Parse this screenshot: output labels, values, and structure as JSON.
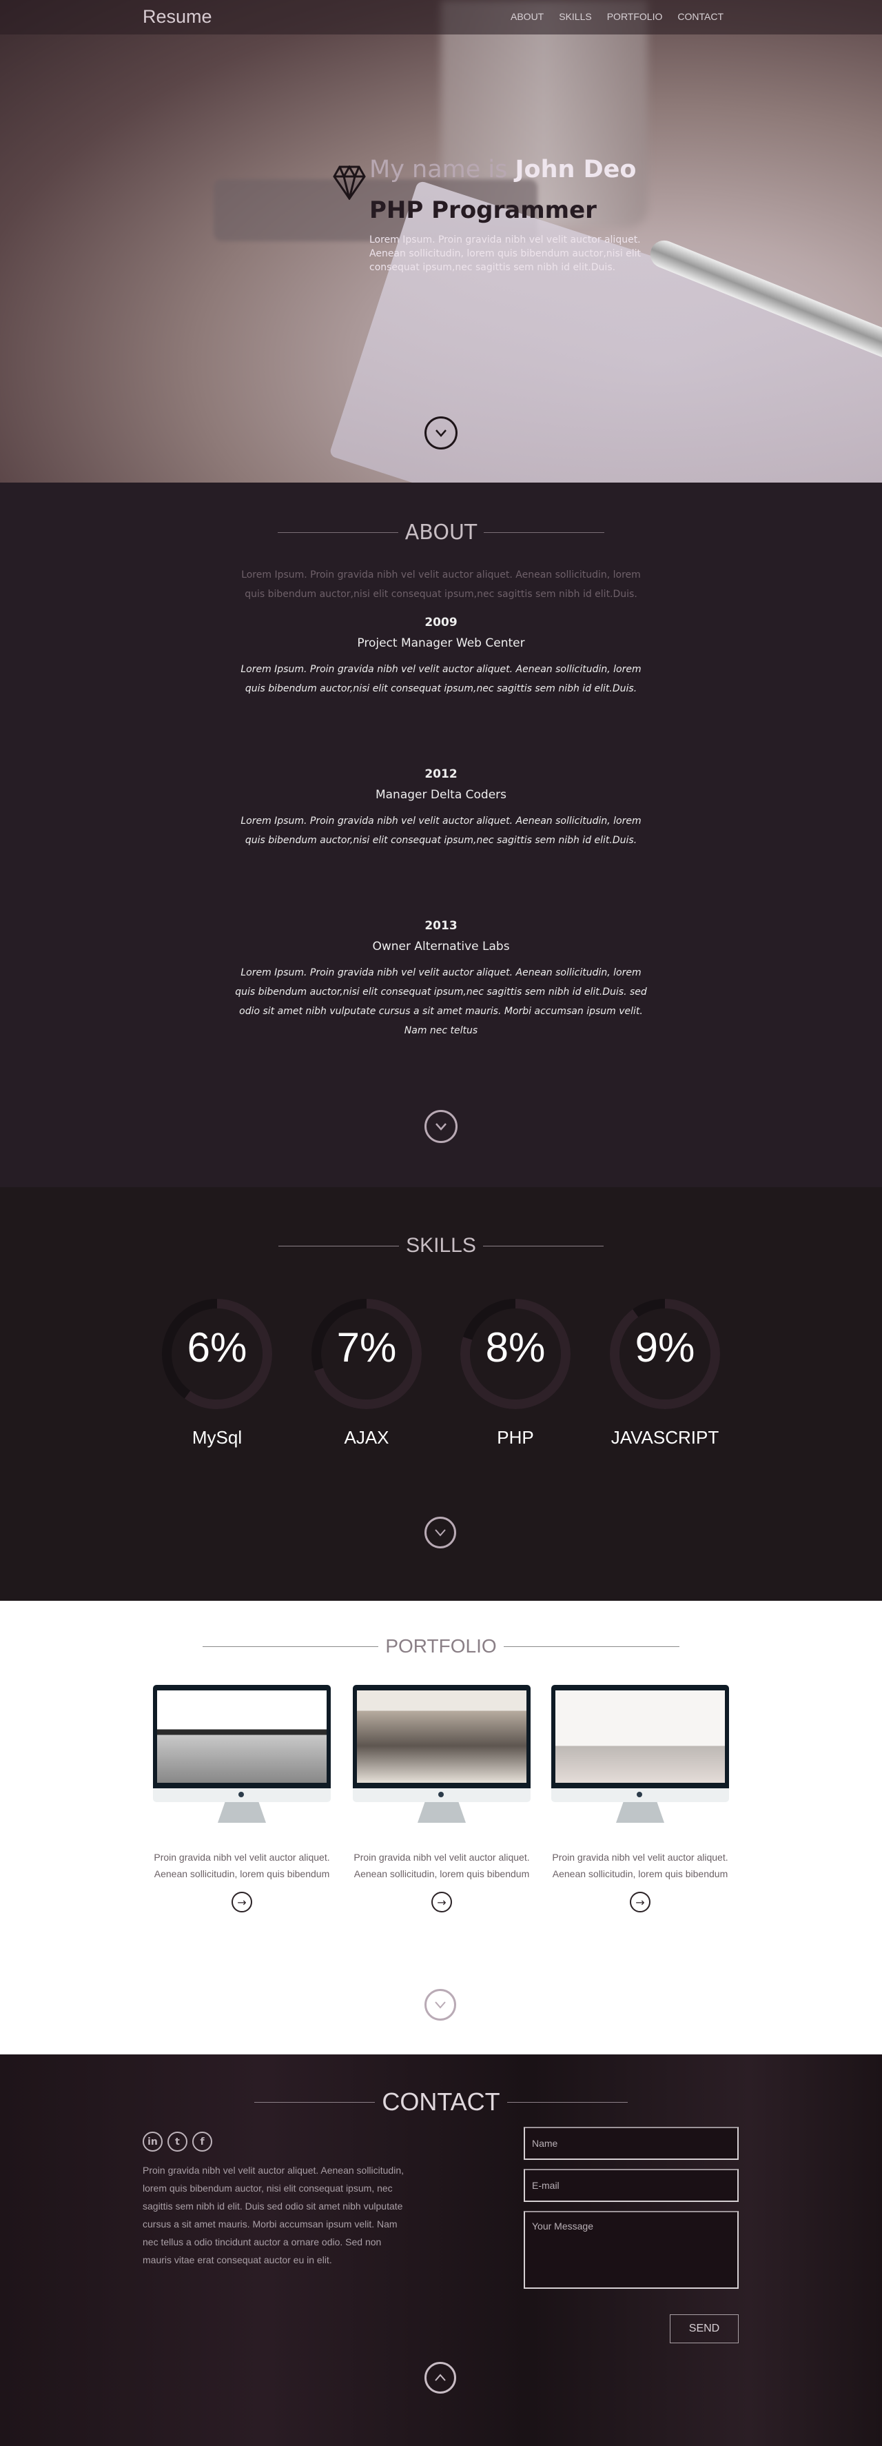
{
  "nav": {
    "brand": "Resume",
    "links": [
      "ABOUT",
      "SKILLS",
      "PORTFOLIO",
      "CONTACT"
    ]
  },
  "hero": {
    "intro": "My name is ",
    "name": "John Deo",
    "role": "PHP Programmer",
    "description": "Lorem Ipsum. Proin gravida nibh vel velit auctor aliquet. Aenean sollicitudin, lorem quis bibendum auctor,nisi elit consequat ipsum,nec sagittis sem nibh id elit.Duis.",
    "icon": "diamond-icon"
  },
  "about": {
    "title": "ABOUT",
    "intro": "Lorem Ipsum. Proin gravida nibh vel velit auctor aliquet. Aenean sollicitudin, lorem quis bibendum auctor,nisi elit consequat ipsum,nec sagittis sem nibh id elit.Duis.",
    "jobs": [
      {
        "year": "2009",
        "role": "Project Manager Web Center",
        "description": "Lorem Ipsum. Proin gravida nibh vel velit auctor aliquet. Aenean sollicitudin, lorem quis bibendum auctor,nisi elit consequat ipsum,nec sagittis sem nibh id elit.Duis."
      },
      {
        "year": "2012",
        "role": "Manager Delta Coders",
        "description": "Lorem Ipsum. Proin gravida nibh vel velit auctor aliquet. Aenean sollicitudin, lorem quis bibendum auctor,nisi elit consequat ipsum,nec sagittis sem nibh id elit.Duis."
      },
      {
        "year": "2013",
        "role": "Owner Alternative Labs",
        "description": "Lorem Ipsum. Proin gravida nibh vel velit auctor aliquet. Aenean sollicitudin, lorem quis bibendum auctor,nisi elit consequat ipsum,nec sagittis sem nibh id elit.Duis. sed odio sit amet nibh vulputate cursus a sit amet mauris. Morbi accumsan ipsum velit. Nam nec teltus"
      }
    ]
  },
  "skills": {
    "title": "SKILLS",
    "items": [
      {
        "name": "MySql",
        "label": "6%",
        "ring_fill": 0.6
      },
      {
        "name": "AJAX",
        "label": "7%",
        "ring_fill": 0.7
      },
      {
        "name": "PHP",
        "label": "8%",
        "ring_fill": 0.8
      },
      {
        "name": "JAVASCRIPT",
        "label": "9%",
        "ring_fill": 0.9
      }
    ],
    "colors": {
      "ring": "#2e2128",
      "ring_empty": "#161114"
    }
  },
  "portfolio": {
    "title": "PORTFOLIO",
    "items": [
      {
        "text": "Proin gravida nibh vel velit auctor aliquet. Aenean sollicitudin, lorem quis bibendum"
      },
      {
        "text": "Proin gravida nibh vel velit auctor aliquet. Aenean sollicitudin, lorem quis bibendum"
      },
      {
        "text": "Proin gravida nibh vel velit auctor aliquet. Aenean sollicitudin, lorem quis bibendum"
      }
    ]
  },
  "contact": {
    "title": "CONTACT",
    "social": [
      "linkedin-icon",
      "twitter-icon",
      "facebook-icon"
    ],
    "text": "Proin gravida nibh vel velit auctor aliquet. Aenean sollicitudin, lorem quis bibendum auctor, nisi elit consequat ipsum, nec sagittis sem nibh id elit. Duis sed odio sit amet nibh vulputate cursus a sit amet mauris. Morbi accumsan ipsum velit. Nam nec tellus a odio tincidunt auctor a ornare odio. Sed non mauris vitae erat consequat auctor eu in elit.",
    "name_placeholder": "Name",
    "email_placeholder": "E-mail",
    "message_placeholder": "Your Message",
    "send_label": "SEND"
  }
}
